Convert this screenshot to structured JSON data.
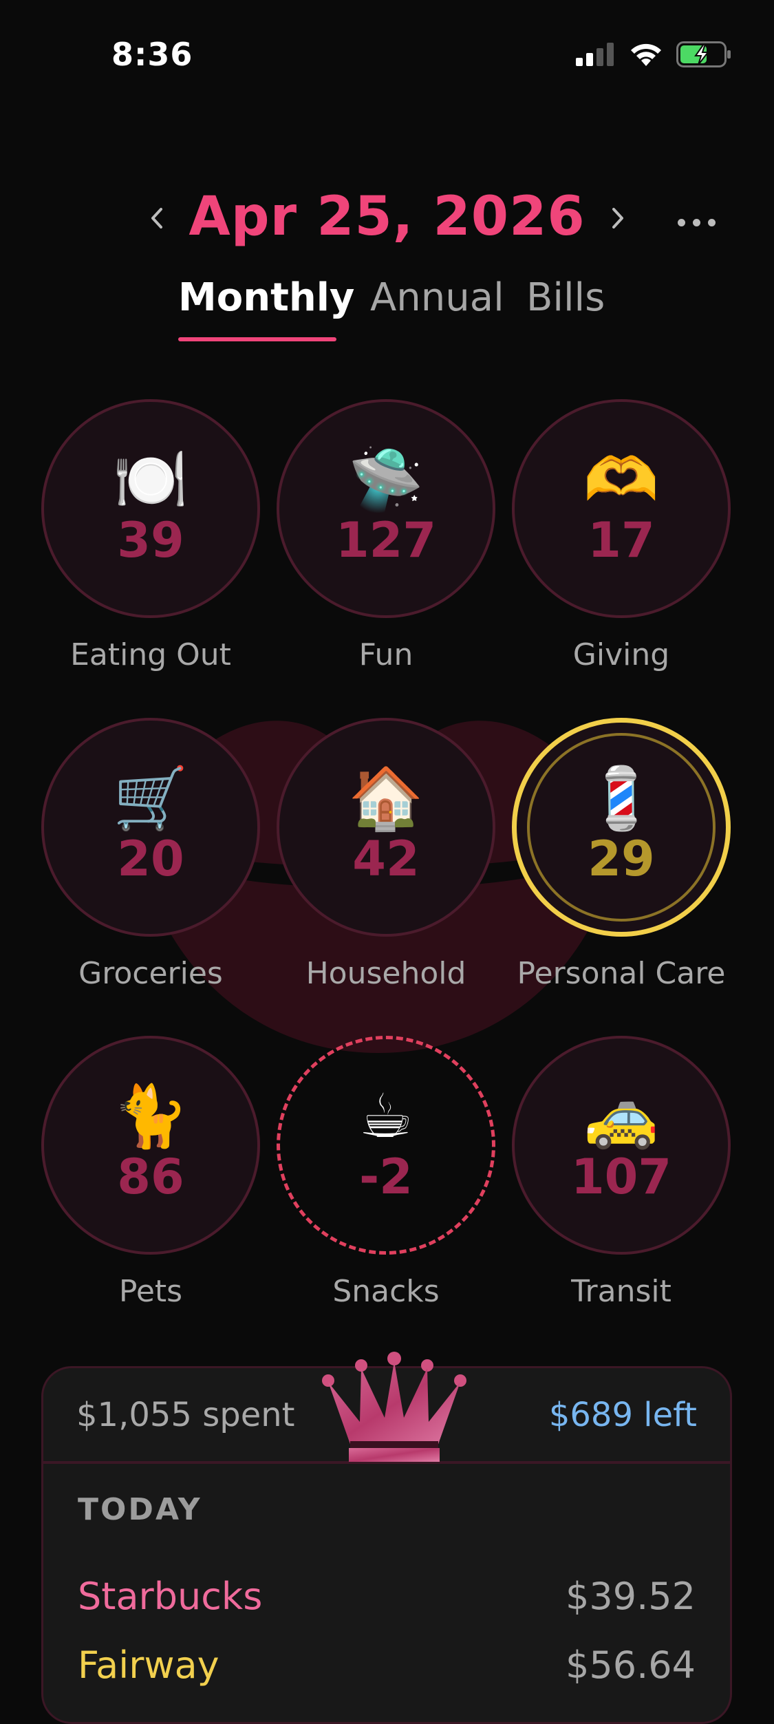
{
  "status": {
    "time": "8:36"
  },
  "header": {
    "date": "Apr 25, 2026",
    "tabs": [
      "Monthly",
      "Annual",
      "Bills"
    ]
  },
  "categories": [
    {
      "emoji": "🍽️",
      "value": "39",
      "label": "Eating Out"
    },
    {
      "emoji": "🛸",
      "value": "127",
      "label": "Fun"
    },
    {
      "emoji": "🫶",
      "value": "17",
      "label": "Giving"
    },
    {
      "emoji": "🛒",
      "value": "20",
      "label": "Groceries"
    },
    {
      "emoji": "🏠",
      "value": "42",
      "label": "Household"
    },
    {
      "emoji": "💈",
      "value": "29",
      "label": "Personal Care"
    },
    {
      "emoji": "🐈",
      "value": "86",
      "label": "Pets"
    },
    {
      "emoji": "☕",
      "value": "-2",
      "label": "Snacks"
    },
    {
      "emoji": "🚕",
      "value": "107",
      "label": "Transit"
    }
  ],
  "summary": {
    "spent": "$1,055 spent",
    "left": "$689 left",
    "section": "TODAY",
    "transactions": [
      {
        "name": "Starbucks",
        "amount": "$39.52",
        "color": "#f06b9c"
      },
      {
        "name": "Fairway",
        "amount": "$56.64",
        "color": "#f2d04e"
      }
    ]
  },
  "colors": {
    "accent": "#f0457a",
    "left": "#78b6f0",
    "selected": "#f2cf4a"
  }
}
